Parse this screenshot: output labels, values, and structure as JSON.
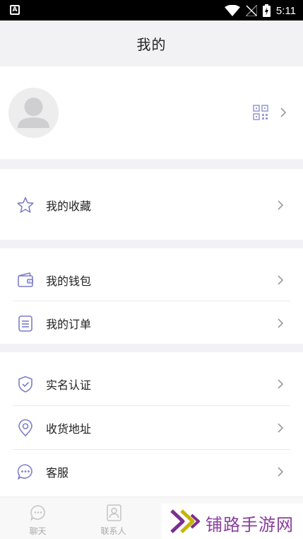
{
  "status_bar": {
    "time": "5:11",
    "app_badge": "A"
  },
  "header": {
    "title": "我的"
  },
  "profile": {
    "avatar_icon": "avatar-placeholder-icon",
    "qr_icon": "qr-code-icon"
  },
  "menu": {
    "favorites": {
      "label": "我的收藏",
      "icon": "star-icon"
    },
    "wallet": {
      "label": "我的钱包",
      "icon": "wallet-icon"
    },
    "orders": {
      "label": "我的订单",
      "icon": "order-list-icon"
    },
    "verification": {
      "label": "实名认证",
      "icon": "shield-check-icon"
    },
    "address": {
      "label": "收货地址",
      "icon": "location-pin-icon"
    },
    "service": {
      "label": "客服",
      "icon": "chat-bubble-icon"
    }
  },
  "tabbar": {
    "tabs": [
      {
        "label": "聊天",
        "icon": "chat-icon"
      },
      {
        "label": "联系人",
        "icon": "contacts-icon"
      }
    ]
  },
  "watermark": {
    "text": "铺路手游网"
  },
  "colors": {
    "accent_icon": "#7b7fc9",
    "chevron": "#9a9a9a",
    "background": "#f2f2f4"
  }
}
